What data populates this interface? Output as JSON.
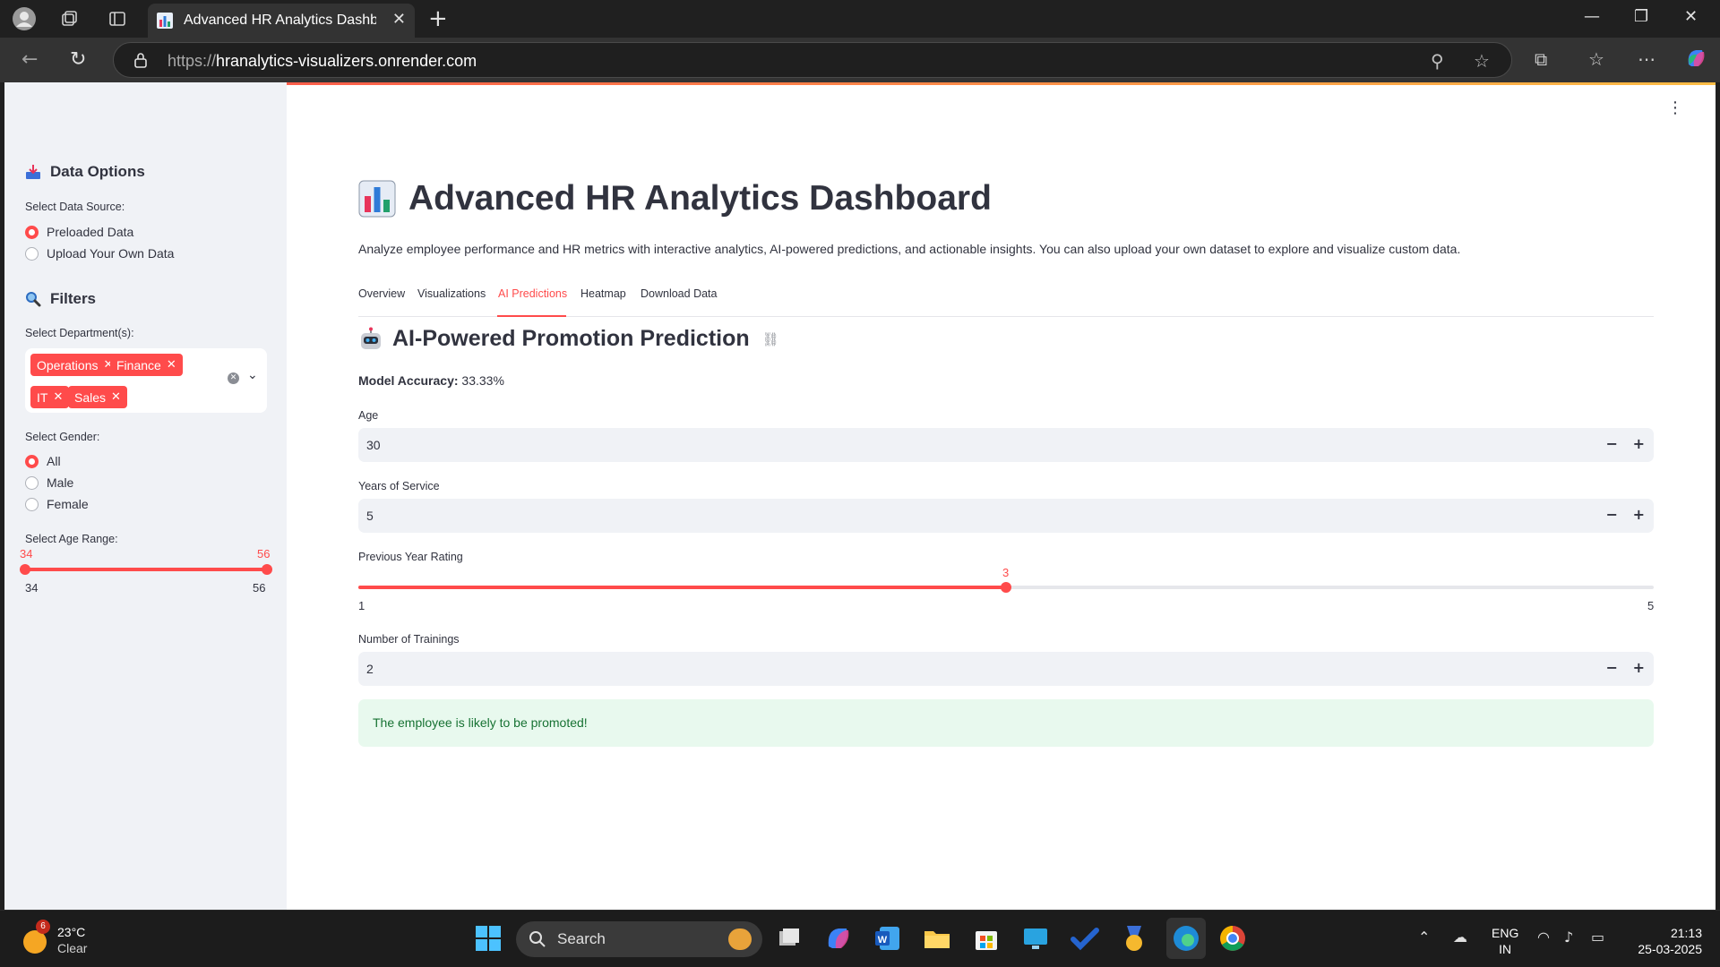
{
  "browser": {
    "tab_title": "Advanced HR Analytics Dashboard",
    "url_protocol": "https://",
    "url_host": "hranalytics-visualizers.onrender.com"
  },
  "sidebar": {
    "data_options_heading": "Data Options",
    "data_source_label": "Select Data Source:",
    "data_source_options": [
      "Preloaded Data",
      "Upload Your Own Data"
    ],
    "data_source_selected": "Preloaded Data",
    "filters_heading": "Filters",
    "department_label": "Select Department(s):",
    "departments": [
      "Operations",
      "Finance",
      "IT",
      "Sales"
    ],
    "gender_label": "Select Gender:",
    "gender_options": [
      "All",
      "Male",
      "Female"
    ],
    "gender_selected": "All",
    "age_range_label": "Select Age Range:",
    "age_low": "34",
    "age_high": "56",
    "age_min_tick": "34",
    "age_max_tick": "56"
  },
  "main": {
    "title": "Advanced HR Analytics Dashboard",
    "intro": "Analyze employee performance and HR metrics with interactive analytics, AI-powered predictions, and actionable insights. You can also upload your own dataset to explore and visualize custom data.",
    "tabs": [
      "Overview",
      "Visualizations",
      "AI Predictions",
      "Heatmap",
      "Download Data"
    ],
    "active_tab": "AI Predictions",
    "section_title": "AI-Powered Promotion Prediction",
    "accuracy_label": "Model Accuracy:",
    "accuracy_value": "33.33%",
    "age_label": "Age",
    "age_value": "30",
    "service_label": "Years of Service",
    "service_value": "5",
    "rating_label": "Previous Year Rating",
    "rating_value": "3",
    "rating_min": "1",
    "rating_max": "5",
    "rating_fraction": 0.5,
    "trainings_label": "Number of Trainings",
    "trainings_value": "2",
    "result_message": "The employee is likely to be promoted!"
  },
  "taskbar": {
    "weather_badge": "6",
    "temperature": "23°C",
    "condition": "Clear",
    "search_label": "Search",
    "lang_top": "ENG",
    "lang_bottom": "IN",
    "time": "21:13",
    "date": "25-03-2025"
  },
  "colors": {
    "accent": "#ff4b4b",
    "sidebar_bg": "#f0f2f6",
    "success_bg": "#e8f9ee",
    "success_text": "#177233"
  },
  "icons": [
    "person-icon",
    "workspaces-icon",
    "tab-actions-icon",
    "chart-favicon",
    "close-icon",
    "new-tab-icon",
    "minimize-icon",
    "restore-icon",
    "back-icon",
    "refresh-icon",
    "lock-icon",
    "zoom-icon",
    "favorite-star-icon",
    "extensions-icon",
    "favorites-icon",
    "more-icon",
    "copilot-icon",
    "inbox-tray-icon",
    "magnifier-icon",
    "robot-icon",
    "link-icon",
    "kebab-menu-icon"
  ]
}
